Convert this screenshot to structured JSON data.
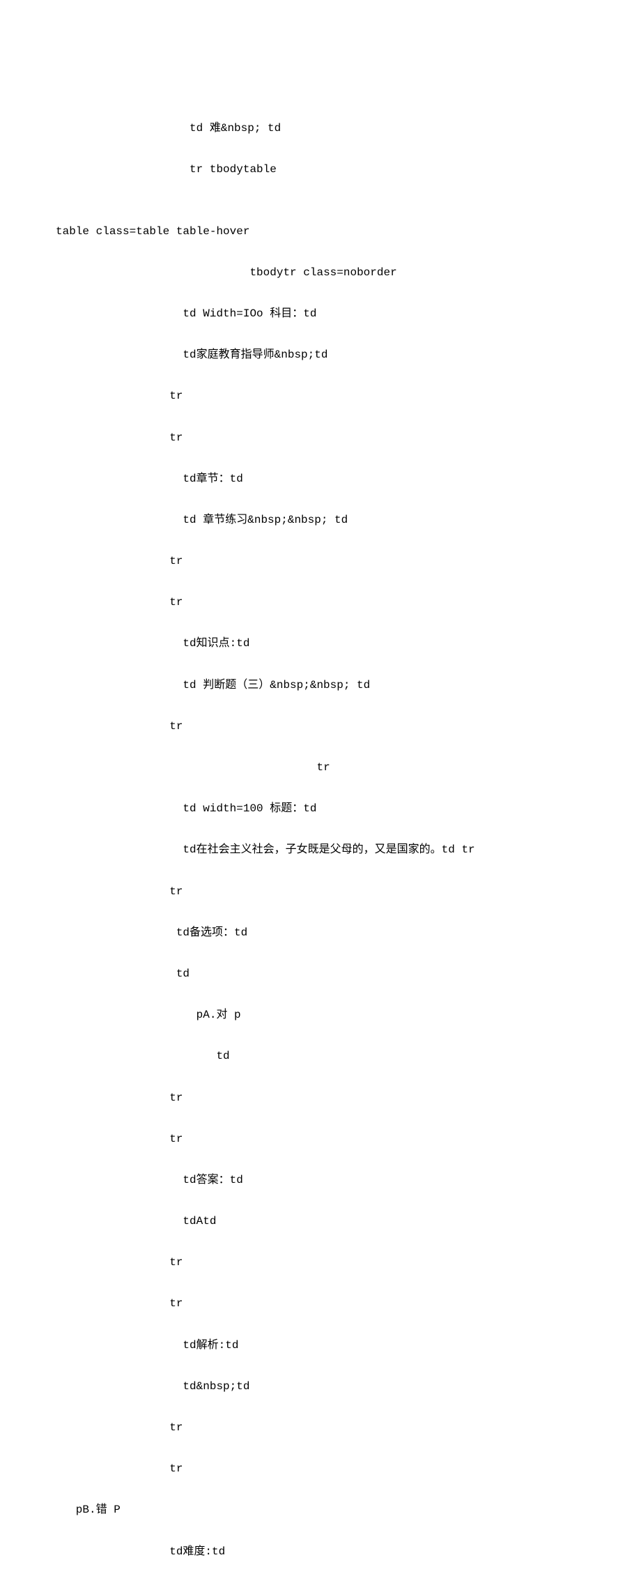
{
  "lines": [
    "                    td 难&nbsp; td",
    "                    tr tbodytable",
    "",
    "table class=table table-hover",
    "                             tbodytr class=noborder",
    "                   td Width=IOo 科目：td",
    "                   td家庭教育指导师&nbsp;td",
    "                 tr",
    "                 tr",
    "                   td章节：td",
    "                   td 章节练习&nbsp;&nbsp; td",
    "                 tr",
    "                 tr",
    "                   td知识点:td",
    "                   td 判断题（三）&nbsp;&nbsp; td",
    "                 tr",
    "                                       tr",
    "                   td width=100 标题：td",
    "                   td在社会主义社会，子女既是父母的，又是国家的。td tr",
    "                 tr",
    "                  td备选项：td",
    "                  td",
    "                     pA.对 p",
    "                        td",
    "                 tr",
    "                 tr",
    "                   td答案：td",
    "                   tdAtd",
    "                 tr",
    "                 tr",
    "                   td解析:td",
    "                   td&nbsp;td",
    "                 tr",
    "                 tr",
    "   pB.错 P",
    "                 td难度:td"
  ]
}
